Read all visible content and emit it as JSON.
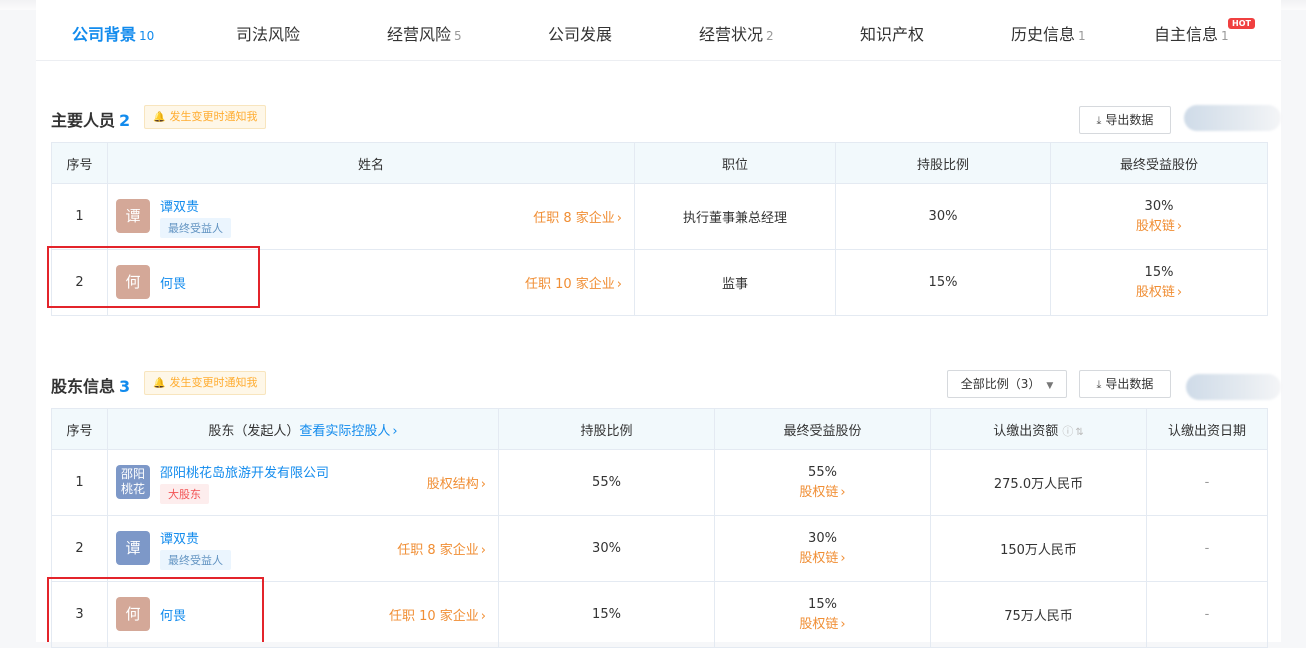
{
  "tabs": [
    {
      "label": "公司背景",
      "count": "10"
    },
    {
      "label": "司法风险",
      "count": ""
    },
    {
      "label": "经营风险",
      "count": "5"
    },
    {
      "label": "公司发展",
      "count": ""
    },
    {
      "label": "经营状况",
      "count": "2"
    },
    {
      "label": "知识产权",
      "count": ""
    },
    {
      "label": "历史信息",
      "count": "1"
    },
    {
      "label": "自主信息",
      "count": "1"
    }
  ],
  "hot_badge": "HOT",
  "personnel": {
    "title": "主要人员",
    "count": "2",
    "notify": "发生变更时通知我",
    "export": "导出数据",
    "headers": [
      "序号",
      "姓名",
      "职位",
      "持股比例",
      "最终受益股份"
    ],
    "rows": [
      {
        "idx": "1",
        "avatar": "谭",
        "name": "谭双贵",
        "tag": "最终受益人",
        "link": "任职 8 家企业",
        "position": "执行董事兼总经理",
        "share": "30%",
        "benefit": "30%",
        "chain": "股权链"
      },
      {
        "idx": "2",
        "avatar": "何",
        "name": "何畏",
        "tag": "",
        "link": "任职 10 家企业",
        "position": "监事",
        "share": "15%",
        "benefit": "15%",
        "chain": "股权链"
      }
    ]
  },
  "shareholders": {
    "title": "股东信息",
    "count": "3",
    "notify": "发生变更时通知我",
    "filter": "全部比例（3）",
    "export": "导出数据",
    "headers": [
      "序号",
      "股东（发起人）",
      "查看实际控股人",
      "持股比例",
      "最终受益股份",
      "认缴出资额",
      "认缴出资日期"
    ],
    "rows": [
      {
        "idx": "1",
        "avatar": "邵阳\n桃花",
        "name": "邵阳桃花岛旅游开发有限公司",
        "tag": "大股东",
        "link": "股权结构",
        "share": "55%",
        "benefit": "55%",
        "chain": "股权链",
        "amount": "275.0万人民币",
        "date": "-"
      },
      {
        "idx": "2",
        "avatar": "谭",
        "name": "谭双贵",
        "tag": "最终受益人",
        "link": "任职 8 家企业",
        "share": "30%",
        "benefit": "30%",
        "chain": "股权链",
        "amount": "150万人民币",
        "date": "-"
      },
      {
        "idx": "3",
        "avatar": "何",
        "name": "何畏",
        "tag": "",
        "link": "任职 10 家企业",
        "share": "15%",
        "benefit": "15%",
        "chain": "股权链",
        "amount": "75万人民币",
        "date": "-"
      }
    ]
  },
  "colors": {
    "accent": "#128bed",
    "orange": "#f08e34",
    "highlight": "#e3242b"
  }
}
